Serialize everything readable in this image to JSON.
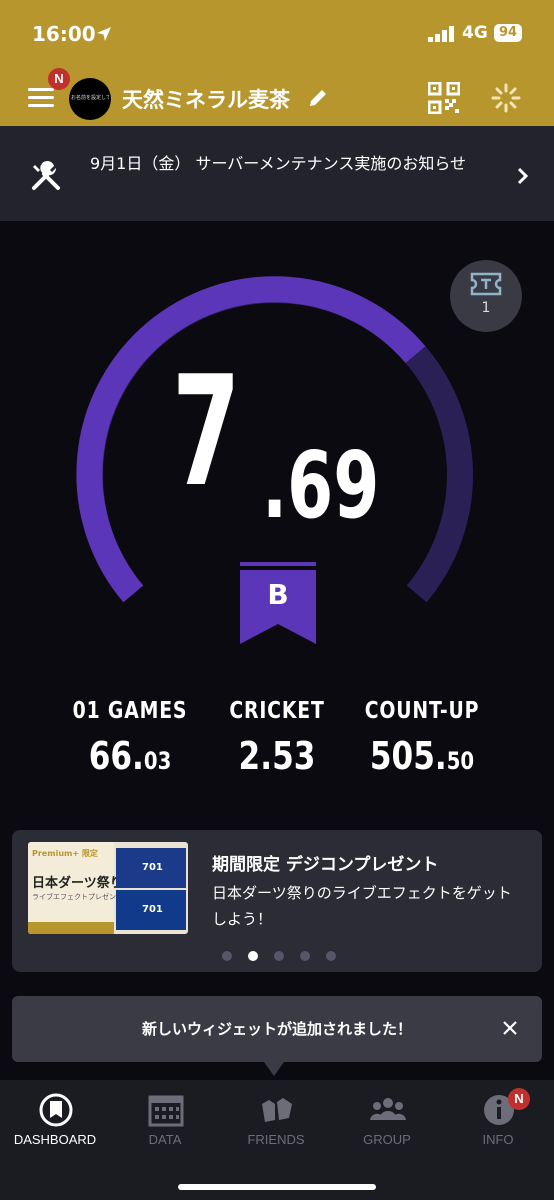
{
  "status_bar": {
    "time": "16:00",
    "network": "4G",
    "battery": "94"
  },
  "header": {
    "menu_badge": "N",
    "avatar_text": "お名前を設定してください",
    "title": "天然ミネラル麦茶"
  },
  "notice": {
    "text": "9月1日（金） サーバーメンテナンス実施のお知らせ"
  },
  "rating": {
    "integer": "7",
    "decimal": ".69",
    "progress": 0.69,
    "grade": "B",
    "ticket_count": "1"
  },
  "stats": [
    {
      "label": "01 GAMES",
      "value_main": "66.",
      "value_small": "03",
      "color": "#c8423f"
    },
    {
      "label": "CRICKET",
      "value_main": "2.53",
      "value_small": "",
      "color": "#4a86c8"
    },
    {
      "label": "COUNT-UP",
      "value_main": "505.",
      "value_small": "50",
      "color": "#6e9a3e"
    }
  ],
  "promo": {
    "image_tag": "Premium+ 限定",
    "image_title": "日本ダーツ祭り",
    "image_sub": "ライブエフェクトプレゼント",
    "image_number": "701",
    "title": "期間限定 デジコンプレゼント",
    "description": "日本ダーツ祭りのライブエフェクトをゲットしよう！",
    "dots": 5,
    "active_dot": 1
  },
  "toast": {
    "text": "新しいウィジェットが追加されました！"
  },
  "tabs": [
    {
      "label": "DASHBOARD",
      "icon": "dashboard-icon",
      "active": true
    },
    {
      "label": "DATA",
      "icon": "calendar-icon",
      "active": false
    },
    {
      "label": "FRIENDS",
      "icon": "friends-icon",
      "active": false
    },
    {
      "label": "GROUP",
      "icon": "group-icon",
      "active": false
    },
    {
      "label": "INFO",
      "icon": "info-icon",
      "active": false,
      "badge": "N"
    }
  ],
  "colors": {
    "gold": "#b8962e",
    "purple": "#5b36b8",
    "purple_dark": "#2b2056",
    "badge_red": "#c0312e"
  }
}
